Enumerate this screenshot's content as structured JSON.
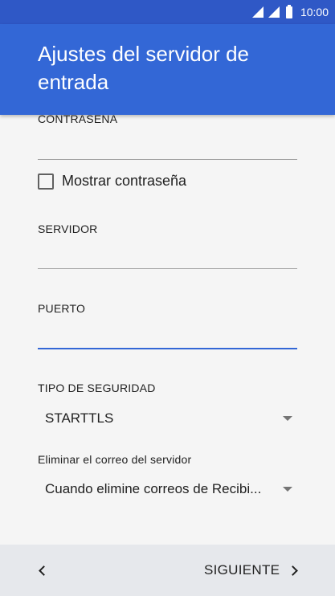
{
  "status_bar": {
    "time": "10:00",
    "icons": [
      "signal-icon",
      "signal-icon",
      "battery-icon"
    ]
  },
  "app_bar": {
    "title": "Ajustes del servidor de entrada",
    "color": "#3367d6"
  },
  "form": {
    "password_label": "CONTRASEÑA",
    "password_value": "",
    "show_password_label": "Mostrar contraseña",
    "show_password_checked": false,
    "server_label": "SERVIDOR",
    "server_value": "",
    "port_label": "PUERTO",
    "port_value": "",
    "security_type_label": "TIPO DE SEGURIDAD",
    "security_type_value": "STARTTLS",
    "delete_mail_label": "Eliminar el correo del servidor",
    "delete_mail_value": "Cuando elimine correos de Recibi..."
  },
  "bottom_bar": {
    "back_icon": "chevron-left-icon",
    "next_label": "SIGUIENTE",
    "next_icon": "chevron-right-icon"
  }
}
